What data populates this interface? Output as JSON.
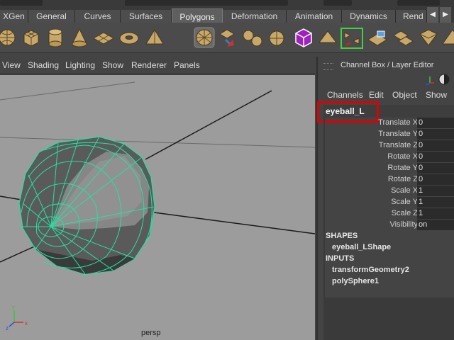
{
  "shelf_tabs": [
    {
      "label": "XGen",
      "active": false
    },
    {
      "label": "General",
      "active": false
    },
    {
      "label": "Curves",
      "active": false
    },
    {
      "label": "Surfaces",
      "active": false
    },
    {
      "label": "Polygons",
      "active": true
    },
    {
      "label": "Deformation",
      "active": false
    },
    {
      "label": "Animation",
      "active": false
    },
    {
      "label": "Dynamics",
      "active": false
    },
    {
      "label": "Rend",
      "active": false
    }
  ],
  "shelf_icons": [
    "poly-sphere-icon",
    "poly-cube-icon",
    "poly-cylinder-icon",
    "poly-cone-icon",
    "poly-plane-icon",
    "poly-torus-icon",
    "poly-pyramid-icon",
    "smooth-icon",
    "extract-icon",
    "combine-icon",
    "separate-icon",
    "bevel-icon",
    "smooth-proxy-icon",
    "bridge-icon",
    "split-polygon-icon",
    "uv-editor-icon",
    "planar-map-icon",
    "sculpt-icon",
    "extrude-icon"
  ],
  "panel_menu": [
    "View",
    "Shading",
    "Lighting",
    "Show",
    "Renderer",
    "Panels"
  ],
  "viewport": {
    "camera": "persp"
  },
  "channel_box": {
    "title": "Channel Box / Layer Editor",
    "menus": [
      "Channels",
      "Edit",
      "Object",
      "Show"
    ],
    "object_name": "eyeball_L",
    "channels": [
      {
        "label": "Translate X",
        "value": "0"
      },
      {
        "label": "Translate Y",
        "value": "0"
      },
      {
        "label": "Translate Z",
        "value": "0"
      },
      {
        "label": "Rotate X",
        "value": "0"
      },
      {
        "label": "Rotate Y",
        "value": "0"
      },
      {
        "label": "Rotate Z",
        "value": "0"
      },
      {
        "label": "Scale X",
        "value": "1"
      },
      {
        "label": "Scale Y",
        "value": "1"
      },
      {
        "label": "Scale Z",
        "value": "1"
      },
      {
        "label": "Visibility",
        "value": "on"
      }
    ],
    "shapes_header": "SHAPES",
    "shapes": [
      "eyeball_LShape"
    ],
    "inputs_header": "INPUTS",
    "inputs": [
      "transformGeometry2",
      "polySphere1"
    ]
  },
  "colors": {
    "highlight": "#e00000",
    "wireframe": "#22e3a0",
    "viewport": "#9c9c9c"
  }
}
